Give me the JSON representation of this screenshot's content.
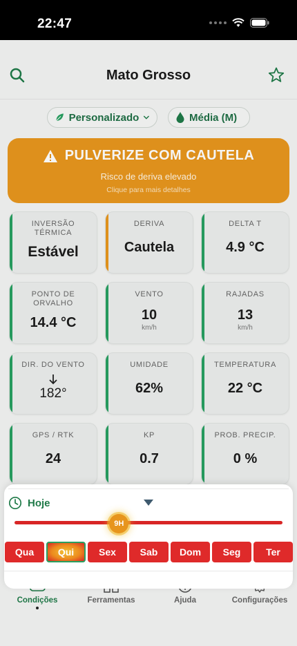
{
  "status": {
    "time": "22:47"
  },
  "header": {
    "title": "Mato Grosso"
  },
  "chips": {
    "mode": "Personalizado",
    "level": "Média (M)"
  },
  "banner": {
    "title": "PULVERIZE COM CAUTELA",
    "subtitle": "Risco de deriva elevado",
    "hint": "Clique para mais detalhes",
    "color": "#e8961e"
  },
  "cards": {
    "inversao": {
      "label": "INVERSÃO TÉRMICA",
      "value": "Estável"
    },
    "deriva": {
      "label": "DERIVA",
      "value": "Cautela"
    },
    "delta_t": {
      "label": "DELTA T",
      "value": "4.9 °C"
    },
    "orvalho": {
      "label": "PONTO DE ORVALHO",
      "value": "14.4 °C"
    },
    "vento": {
      "label": "VENTO",
      "value": "10",
      "unit": "km/h"
    },
    "rajadas": {
      "label": "RAJADAS",
      "value": "13",
      "unit": "km/h"
    },
    "dir_vento": {
      "label": "DIR. DO VENTO",
      "value": "182°",
      "icon": "arrow-down-icon"
    },
    "umidade": {
      "label": "UMIDADE",
      "value": "62%"
    },
    "temperatura": {
      "label": "TEMPERATURA",
      "value": "22 °C"
    },
    "gps": {
      "label": "GPS / RTK",
      "value": "24"
    },
    "kp": {
      "label": "KP",
      "value": "0.7"
    },
    "precip": {
      "label": "PROB. PRECIP.",
      "value": "0 %"
    }
  },
  "sheet": {
    "day_label": "Hoje",
    "hour_label": "9H",
    "hour_fraction": 0.39,
    "days": [
      "Qua",
      "Qui",
      "Sex",
      "Sab",
      "Dom",
      "Seg",
      "Ter"
    ],
    "selected_day": "Qui"
  },
  "tabs": {
    "condicoes": "Condições",
    "ferramentas": "Ferramentas",
    "ajuda": "Ajuda",
    "configuracoes": "Configurações"
  },
  "colors": {
    "green": "#1f7a48",
    "orange": "#e8961e",
    "red": "#df2a2a"
  }
}
